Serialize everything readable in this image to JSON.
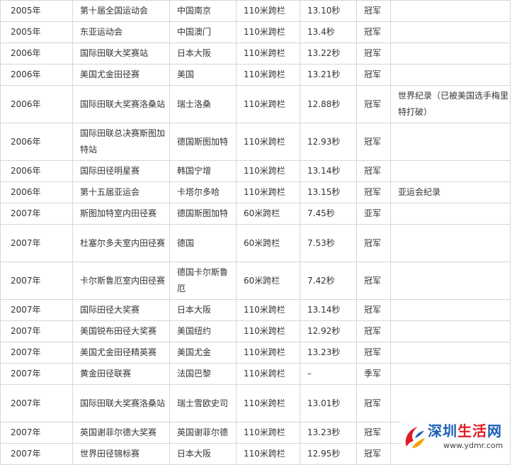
{
  "rows": [
    {
      "year": "2005年",
      "event": "第十届全国运动会",
      "location": "中国南京",
      "discipline": "110米跨栏",
      "time": "13.10秒",
      "place": "冠军",
      "note": ""
    },
    {
      "year": "2005年",
      "event": "东亚运动会",
      "location": "中国澳门",
      "discipline": "110米跨栏",
      "time": "13.4秒",
      "place": "冠军",
      "note": ""
    },
    {
      "year": "2006年",
      "event": "国际田联大奖赛站",
      "location": "日本大阪",
      "discipline": "110米跨栏",
      "time": "13.22秒",
      "place": "冠军",
      "note": ""
    },
    {
      "year": "2006年",
      "event": "美国尤金田径赛",
      "location": "美国",
      "discipline": "110米跨栏",
      "time": "13.21秒",
      "place": "冠军",
      "note": ""
    },
    {
      "year": "2006年",
      "event": "国际田联大奖赛洛桑站",
      "location": "瑞士洛桑",
      "discipline": "110米跨栏",
      "time": "12.88秒",
      "place": "冠军",
      "note": "世界纪录（已被美国选手梅里特打破）"
    },
    {
      "year": "2006年",
      "event": "国际田联总决赛斯图加特站",
      "location": "德国斯图加特",
      "discipline": "110米跨栏",
      "time": "12.93秒",
      "place": "冠军",
      "note": ""
    },
    {
      "year": "2006年",
      "event": "国际田径明星赛",
      "location": "韩国宁增",
      "discipline": "110米跨栏",
      "time": "13.14秒",
      "place": "冠军",
      "note": ""
    },
    {
      "year": "2006年",
      "event": "第十五届亚运会",
      "location": "卡塔尔多哈",
      "discipline": "110米跨栏",
      "time": "13.15秒",
      "place": "冠军",
      "note": "亚运会纪录"
    },
    {
      "year": "2007年",
      "event": "斯图加特室内田径赛",
      "location": "德国斯图加特",
      "discipline": "60米跨栏",
      "time": "7.45秒",
      "place": "亚军",
      "note": ""
    },
    {
      "year": "2007年",
      "event": "杜塞尔多夫室内田径赛",
      "location": "德国",
      "discipline": "60米跨栏",
      "time": "7.53秒",
      "place": "冠军",
      "note": ""
    },
    {
      "year": "2007年",
      "event": "卡尔斯鲁厄室内田径赛",
      "location": "德国卡尔斯鲁厄",
      "discipline": "60米跨栏",
      "time": "7.42秒",
      "place": "冠军",
      "note": ""
    },
    {
      "year": "2007年",
      "event": "国际田径大奖赛",
      "location": "日本大阪",
      "discipline": "110米跨栏",
      "time": "13.14秒",
      "place": "冠军",
      "note": ""
    },
    {
      "year": "2007年",
      "event": "美国锐布田径大奖赛",
      "location": "美国纽约",
      "discipline": "110米跨栏",
      "time": "12.92秒",
      "place": "冠军",
      "note": ""
    },
    {
      "year": "2007年",
      "event": "美国尤金田径精英赛",
      "location": "美国尤金",
      "discipline": "110米跨栏",
      "time": "13.23秒",
      "place": "冠军",
      "note": ""
    },
    {
      "year": "2007年",
      "event": "黄金田径联赛",
      "location": "法国巴黎",
      "discipline": "110米跨栏",
      "time": "–",
      "place": "季军",
      "note": ""
    },
    {
      "year": "2007年",
      "event": "国际田联大奖赛洛桑站",
      "location": "瑞士雪欧史司",
      "discipline": "110米跨栏",
      "time": "13.01秒",
      "place": "冠军",
      "note": ""
    },
    {
      "year": "2007年",
      "event": "英国谢菲尔德大奖赛",
      "location": "英国谢菲尔德",
      "discipline": "110米跨栏",
      "time": "13.23秒",
      "place": "冠军",
      "note": ""
    },
    {
      "year": "2007年",
      "event": "世界田径锦标赛",
      "location": "日本大阪",
      "discipline": "110米跨栏",
      "time": "12.95秒",
      "place": "冠军",
      "note": ""
    }
  ],
  "watermark": {
    "name_part1": "深圳",
    "name_part2": "生活",
    "name_part3": "网",
    "url": "www.ydmr.com",
    "swirl_icon": "logo-swirl-icon",
    "colors": {
      "blue": "#1a5fb4",
      "red": "#e01b24",
      "orange": "#f6a000"
    }
  }
}
